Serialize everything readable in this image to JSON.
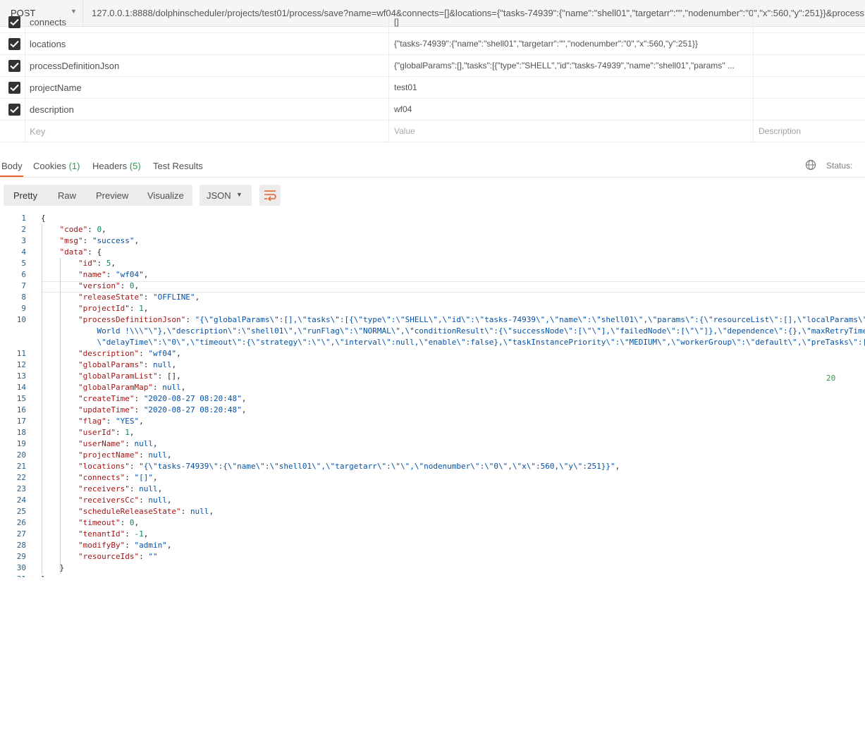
{
  "request": {
    "method": "POST",
    "url": "127.0.0.1:8888/dolphinscheduler/projects/test01/process/save?name=wf04&connects=[]&locations={\"tasks-74939\":{\"name\":\"shell01\",\"targetarr\":\"\",\"nodenumber\":\"0\",\"x\":560,\"y\":251}}&processDefinit"
  },
  "params": {
    "rows": [
      {
        "key": "connects",
        "value": "[]",
        "checked": true
      },
      {
        "key": "locations",
        "value": "{\"tasks-74939\":{\"name\":\"shell01\",\"targetarr\":\"\",\"nodenumber\":\"0\",\"x\":560,\"y\":251}}",
        "checked": true
      },
      {
        "key": "processDefinitionJson",
        "value": "{\"globalParams\":[],\"tasks\":[{\"type\":\"SHELL\",\"id\":\"tasks-74939\",\"name\":\"shell01\",\"params\" ...",
        "checked": true
      },
      {
        "key": "projectName",
        "value": "test01",
        "checked": true
      },
      {
        "key": "description",
        "value": "wf04",
        "checked": true
      }
    ],
    "placeholder": {
      "key": "Key",
      "value": "Value",
      "description": "Description"
    }
  },
  "response_tabs": {
    "body": "Body",
    "cookies": "Cookies",
    "cookies_count": "(1)",
    "headers": "Headers",
    "headers_count": "(5)",
    "tests": "Test Results",
    "status_label": "Status:",
    "status_code": "20"
  },
  "toolbar": {
    "pretty": "Pretty",
    "raw": "Raw",
    "preview": "Preview",
    "visualize": "Visualize",
    "format": "JSON"
  },
  "code_lines": [
    {
      "n": "1",
      "t": "{"
    },
    {
      "n": "2",
      "t": "    \"code\": 0,"
    },
    {
      "n": "3",
      "t": "    \"msg\": \"success\","
    },
    {
      "n": "4",
      "t": "    \"data\": {"
    },
    {
      "n": "5",
      "t": "        \"id\": 5,"
    },
    {
      "n": "6",
      "t": "        \"name\": \"wf04\","
    },
    {
      "n": "7",
      "t": "        \"version\": 0,"
    },
    {
      "n": "8",
      "t": "        \"releaseState\": \"OFFLINE\","
    },
    {
      "n": "9",
      "t": "        \"projectId\": 1,"
    },
    {
      "n": "10",
      "t": "        \"processDefinitionJson\": \"{\\\"globalParams\\\":[],\\\"tasks\\\":[{\\\"type\\\":\\\"SHELL\\\",\\\"id\\\":\\\"tasks-74939\\\",\\\"name\\\":\\\"shell01\\\",\\\"params\\\":{\\\"resourceList\\\":[],\\\"localParams\\\""
    },
    {
      "n": "",
      "t": "            World !\\\\\\\"\\\"},\\\"description\\\":\\\"shell01\\\",\\\"runFlag\\\":\\\"NORMAL\\\",\\\"conditionResult\\\":{\\\"successNode\\\":[\\\"\\\"],\\\"failedNode\\\":[\\\"\\\"]},\\\"dependence\\\":{},\\\"maxRetryTimes"
    },
    {
      "n": "",
      "t": "            \\\"delayTime\\\":\\\"0\\\",\\\"timeout\\\":{\\\"strategy\\\":\\\"\\\",\\\"interval\\\":null,\\\"enable\\\":false},\\\"taskInstancePriority\\\":\\\"MEDIUM\\\",\\\"workerGroup\\\":\\\"default\\\",\\\"preTasks\\\":["
    },
    {
      "n": "11",
      "t": "        \"description\": \"wf04\","
    },
    {
      "n": "12",
      "t": "        \"globalParams\": null,"
    },
    {
      "n": "13",
      "t": "        \"globalParamList\": [],"
    },
    {
      "n": "14",
      "t": "        \"globalParamMap\": null,"
    },
    {
      "n": "15",
      "t": "        \"createTime\": \"2020-08-27 08:20:48\","
    },
    {
      "n": "16",
      "t": "        \"updateTime\": \"2020-08-27 08:20:48\","
    },
    {
      "n": "17",
      "t": "        \"flag\": \"YES\","
    },
    {
      "n": "18",
      "t": "        \"userId\": 1,"
    },
    {
      "n": "19",
      "t": "        \"userName\": null,"
    },
    {
      "n": "20",
      "t": "        \"projectName\": null,"
    },
    {
      "n": "21",
      "t": "        \"locations\": \"{\\\"tasks-74939\\\":{\\\"name\\\":\\\"shell01\\\",\\\"targetarr\\\":\\\"\\\",\\\"nodenumber\\\":\\\"0\\\",\\\"x\\\":560,\\\"y\\\":251}}\","
    },
    {
      "n": "22",
      "t": "        \"connects\": \"[]\","
    },
    {
      "n": "23",
      "t": "        \"receivers\": null,"
    },
    {
      "n": "24",
      "t": "        \"receiversCc\": null,"
    },
    {
      "n": "25",
      "t": "        \"scheduleReleaseState\": null,"
    },
    {
      "n": "26",
      "t": "        \"timeout\": 0,"
    },
    {
      "n": "27",
      "t": "        \"tenantId\": -1,"
    },
    {
      "n": "28",
      "t": "        \"modifyBy\": \"admin\","
    },
    {
      "n": "29",
      "t": "        \"resourceIds\": \"\""
    },
    {
      "n": "30",
      "t": "    }"
    },
    {
      "n": "31",
      "t": "}"
    }
  ],
  "colors": {
    "accent": "#e8652f",
    "count_green": "#2e9a4a"
  }
}
